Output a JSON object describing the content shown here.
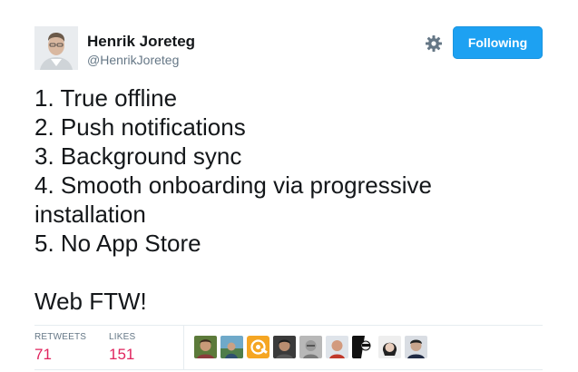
{
  "author": {
    "name": "Henrik Joreteg",
    "handle": "@HenrikJoreteg"
  },
  "actions": {
    "settings_icon": "gear-icon",
    "follow_label": "Following"
  },
  "tweet": {
    "lines": [
      "1. True offline",
      "2. Push notifications",
      "3. Background sync",
      "4. Smooth onboarding via progressive",
      "installation",
      "5. No App Store",
      "Web FTW!"
    ]
  },
  "stats": {
    "retweets_label": "RETWEETS",
    "retweets_value": "71",
    "likes_label": "LIKES",
    "likes_value": "151"
  },
  "colors": {
    "accent": "#1da1f2",
    "stat_value": "#e0245e",
    "muted": "#657786"
  }
}
